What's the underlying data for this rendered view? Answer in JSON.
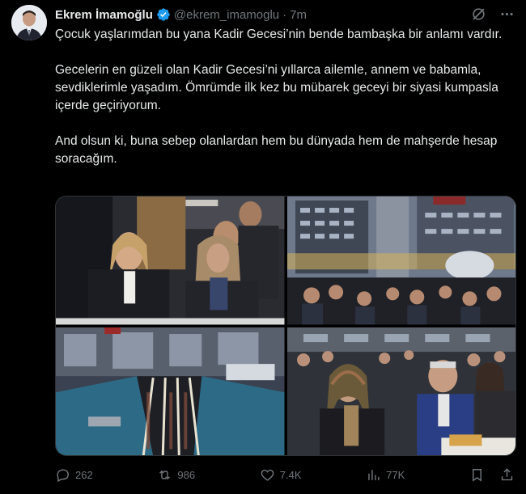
{
  "author": {
    "name": "Ekrem İmamoğlu",
    "handle": "@ekrem_imamoglu",
    "separator": "·",
    "time": "7m"
  },
  "tweet": {
    "paragraphs": [
      "Çocuk yaşlarımdan bu yana Kadir Gecesi’nin bende bambaşka bir anlamı vardır.",
      "Gecelerin en güzeli olan Kadir Gecesi’ni yıllarca ailemle, annem ve babamla, sevdiklerimle yaşadım. Ömrümde ilk kez bu mübarek geceyi bir siyasi kumpasla içerde geçiriyorum.",
      "And olsun ki, buna sebep olanlardan hem bu dünyada hem de mahşerde hesap soracağım."
    ]
  },
  "media": [
    {
      "kind": "photo",
      "subject": "women seated at iftar table"
    },
    {
      "kind": "photo",
      "subject": "crowd in front of municipal building"
    },
    {
      "kind": "photo",
      "subject": "aerial view of long iftar tables"
    },
    {
      "kind": "photo",
      "subject": "elderly guests at iftar dinner"
    }
  ],
  "metrics": {
    "replies": "262",
    "reposts": "986",
    "likes": "7.4K",
    "views": "77K"
  },
  "icons": {
    "verified": "verified-badge-icon",
    "grok": "grok-icon",
    "more": "more-icon",
    "reply": "reply-icon",
    "repost": "repost-icon",
    "like": "like-icon",
    "views": "views-icon",
    "bookmark": "bookmark-icon",
    "share": "share-icon"
  },
  "colors": {
    "background": "#000000",
    "text": "#e7e9ea",
    "muted": "#71767b",
    "verified": "#1d9bf0"
  }
}
